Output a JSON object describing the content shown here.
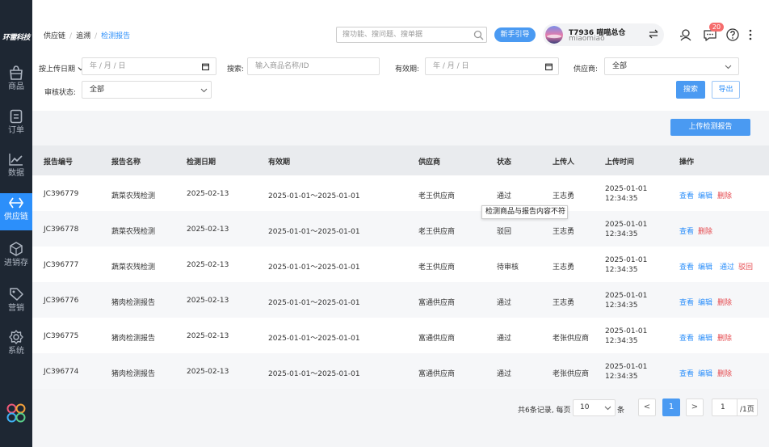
{
  "app": {
    "logo": "环雷科技"
  },
  "sidebar": {
    "items": [
      {
        "label": "商品",
        "icon": "bag-icon"
      },
      {
        "label": "订单",
        "icon": "order-icon"
      },
      {
        "label": "数据",
        "icon": "chart-icon"
      },
      {
        "label": "供应链",
        "icon": "supply-chain-icon",
        "active": true
      },
      {
        "label": "进销存",
        "icon": "inventory-icon"
      },
      {
        "label": "营销",
        "icon": "tag-icon"
      },
      {
        "label": "系统",
        "icon": "settings-icon"
      }
    ]
  },
  "header": {
    "breadcrumb": [
      "供应链",
      "追溯",
      "检测报告"
    ],
    "search_placeholder": "搜功能、搜问题、搜单据",
    "guide_label": "新手引导",
    "store_name": "T7936 喵喵总仓",
    "store_sub": "miaomiao",
    "message_count": "20"
  },
  "filters": {
    "date_type_label": "按上传日期",
    "date_placeholder": "年 / 月 / 日",
    "search_label": "搜索:",
    "search_placeholder": "输入商品名称/ID",
    "validity_label": "有效期:",
    "validity_placeholder": "年 / 月 / 日",
    "supplier_label": "供应商:",
    "supplier_value": "全部",
    "audit_label": "审核状态:",
    "audit_value": "全部",
    "search_button": "搜索",
    "export_button": "导出"
  },
  "upload_button": "上传检测报告",
  "table": {
    "headers": [
      "报告编号",
      "报告名称",
      "检测日期",
      "有效期",
      "供应商",
      "状态",
      "上传人",
      "上传时间",
      "操作"
    ],
    "rows": [
      {
        "id": "JC396779",
        "name": "蔬菜农残检测",
        "date": "2025-02-13",
        "validity": "2025-01-01～2025-01-01",
        "supplier": "老王供应商",
        "status": "通过",
        "uploader": "王志勇",
        "time": "2025-01-01 12:34:35",
        "actions": [
          "查看",
          "编辑",
          "删除"
        ]
      },
      {
        "id": "JC396778",
        "name": "蔬菜农残检测",
        "date": "2025-02-13",
        "validity": "2025-01-01～2025-01-01",
        "supplier": "老王供应商",
        "status": "驳回",
        "uploader": "王志勇",
        "time": "2025-01-01 12:34:35",
        "actions": [
          "查看",
          "删除"
        ]
      },
      {
        "id": "JC396777",
        "name": "蔬菜农残检测",
        "date": "2025-02-13",
        "validity": "2025-01-01～2025-01-01",
        "supplier": "老王供应商",
        "status": "待审核",
        "uploader": "王志勇",
        "time": "2025-01-01 12:34:35",
        "actions": [
          "查看",
          "编辑",
          "通过",
          "驳回"
        ]
      },
      {
        "id": "JC396776",
        "name": "猪肉检测报告",
        "date": "2025-02-13",
        "validity": "2025-01-01～2025-01-01",
        "supplier": "富通供应商",
        "status": "通过",
        "uploader": "王志勇",
        "time": "2025-01-01 12:34:35",
        "actions": [
          "查看",
          "编辑",
          "删除"
        ]
      },
      {
        "id": "JC396775",
        "name": "猪肉检测报告",
        "date": "2025-02-13",
        "validity": "2025-01-01～2025-01-01",
        "supplier": "富通供应商",
        "status": "通过",
        "uploader": "老张供应商",
        "time": "2025-01-01 12:34:35",
        "actions": [
          "查看",
          "编辑",
          "删除"
        ]
      },
      {
        "id": "JC396774",
        "name": "猪肉检测报告",
        "date": "2025-02-13",
        "validity": "2025-01-01～2025-01-01",
        "supplier": "富通供应商",
        "status": "通过",
        "uploader": "老张供应商",
        "time": "2025-01-01 12:34:35",
        "actions": [
          "查看",
          "编辑",
          "删除"
        ]
      }
    ]
  },
  "tooltip": "检测商品与报告内容不符",
  "pagination": {
    "summary": "共6条记录, 每页",
    "page_size": "10",
    "unit": "条",
    "prev": "<",
    "current": "1",
    "next": ">",
    "goto_value": "1",
    "total_pages": "/1页"
  },
  "colors": {
    "accent": "#2c8ffa",
    "danger": "#e5484d",
    "sidebar": "#1e2733"
  }
}
